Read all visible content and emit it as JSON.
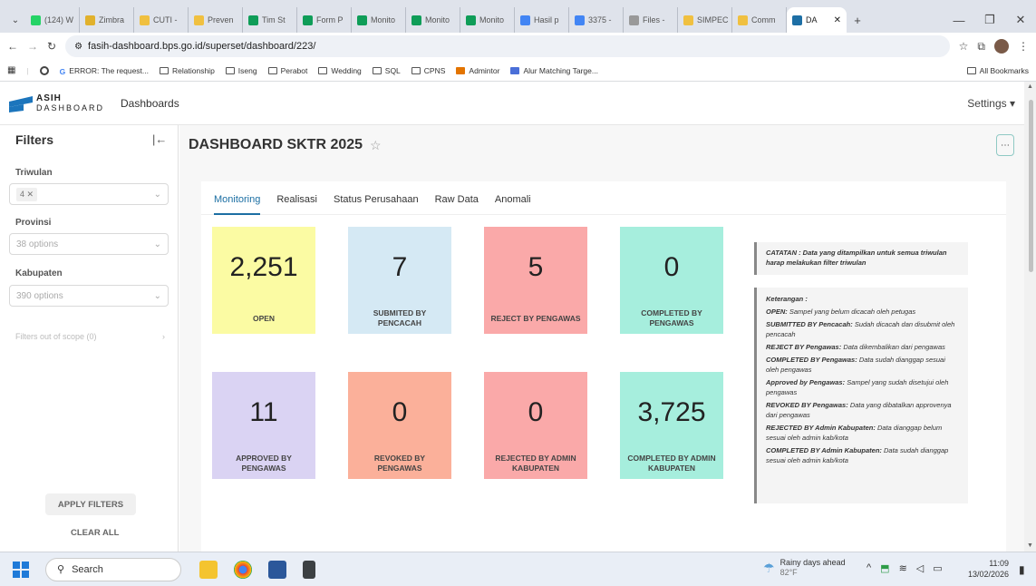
{
  "browser": {
    "tabs": [
      {
        "label": "(124) W",
        "color": "#25d366"
      },
      {
        "label": "Zimbra",
        "color": "#e1b12c"
      },
      {
        "label": "CUTI -",
        "color": "#f0c040"
      },
      {
        "label": "Preven",
        "color": "#f0c040"
      },
      {
        "label": "Tim St",
        "color": "#0f9d58"
      },
      {
        "label": "Form P",
        "color": "#0f9d58"
      },
      {
        "label": "Monito",
        "color": "#0f9d58"
      },
      {
        "label": "Monito",
        "color": "#0f9d58"
      },
      {
        "label": "Monito",
        "color": "#0f9d58"
      },
      {
        "label": "Hasil p",
        "color": "#4285f4"
      },
      {
        "label": "3375 -",
        "color": "#4285f4"
      },
      {
        "label": "Files -",
        "color": "#999999"
      },
      {
        "label": "SIMPEC",
        "color": "#f0c040"
      },
      {
        "label": "Comm",
        "color": "#f0c040"
      }
    ],
    "active_tab": "DA",
    "url": "fasih-dashboard.bps.go.id/superset/dashboard/223/",
    "bookmarks": [
      "ERROR: The request...",
      "Relationship",
      "Iseng",
      "Perabot",
      "Wedding",
      "SQL",
      "CPNS",
      "Admintor",
      "Alur Matching Targe..."
    ],
    "all_bookmarks": "All Bookmarks"
  },
  "app": {
    "logo_top": "ASIH",
    "logo_bottom": "DASHBOARD",
    "nav_dashboards": "Dashboards",
    "settings": "Settings",
    "dashboard_title": "DASHBOARD SKTR 2025"
  },
  "filters": {
    "title": "Filters",
    "triwulan_label": "Triwulan",
    "triwulan_value": "4",
    "provinsi_label": "Provinsi",
    "provinsi_placeholder": "38 options",
    "kabupaten_label": "Kabupaten",
    "kabupaten_placeholder": "390 options",
    "out_of_scope": "Filters out of scope (0)",
    "apply": "APPLY FILTERS",
    "clear": "CLEAR ALL"
  },
  "tabs": [
    "Monitoring",
    "Realisasi",
    "Status Perusahaan",
    "Raw Data",
    "Anomali"
  ],
  "cards": [
    {
      "value": "2,251",
      "label": "OPEN",
      "color": "#fbfba3"
    },
    {
      "value": "7",
      "label": "SUBMITED BY PENCACAH",
      "color": "#d5e9f4"
    },
    {
      "value": "5",
      "label": "REJECT BY PENGAWAS",
      "color": "#faa9a9"
    },
    {
      "value": "0",
      "label": "COMPLETED BY PENGAWAS",
      "color": "#a6eedd"
    },
    {
      "value": "11",
      "label": "APPROVED BY PENGAWAS",
      "color": "#dad3f3"
    },
    {
      "value": "0",
      "label": "REVOKED BY PENGAWAS",
      "color": "#fbb09a"
    },
    {
      "value": "0",
      "label": "REJECTED BY ADMIN KABUPATEN",
      "color": "#faa9a9"
    },
    {
      "value": "3,725",
      "label": "COMPLETED BY ADMIN KABUPATEN",
      "color": "#a6eedd"
    }
  ],
  "catatan": "CATATAN : Data yang ditampilkan untuk semua triwulan harap melakukan filter triwulan",
  "keterangan": {
    "title": "Keterangan :",
    "items": [
      {
        "term": "OPEN:",
        "desc": "Sampel yang belum dicacah oleh petugas"
      },
      {
        "term": "SUBMITTED BY Pencacah:",
        "desc": "Sudah dicacah dan disubmit oleh pencacah"
      },
      {
        "term": "REJECT BY Pengawas:",
        "desc": "Data dikembalikan dari pengawas"
      },
      {
        "term": "COMPLETED BY Pengawas:",
        "desc": "Data sudah dianggap sesuai oleh pengawas"
      },
      {
        "term": "Approved by Pengawas:",
        "desc": "Sampel yang sudah disetujui oleh pengawas"
      },
      {
        "term": "REVOKED BY Pengawas:",
        "desc": "Data yang dibatalkan approvenya dari pengawas"
      },
      {
        "term": "REJECTED BY Admin Kabupaten:",
        "desc": "Data dianggap belum sesuai oleh admin kab/kota"
      },
      {
        "term": "COMPLETED BY Admin Kabupaten:",
        "desc": "Data sudah dianggap sesuai oleh admin kab/kota"
      }
    ]
  },
  "taskbar": {
    "search": "Search",
    "weather_title": "Rainy days ahead",
    "weather_temp": "82°F",
    "time": "11:09",
    "date": "13/02/2026"
  }
}
